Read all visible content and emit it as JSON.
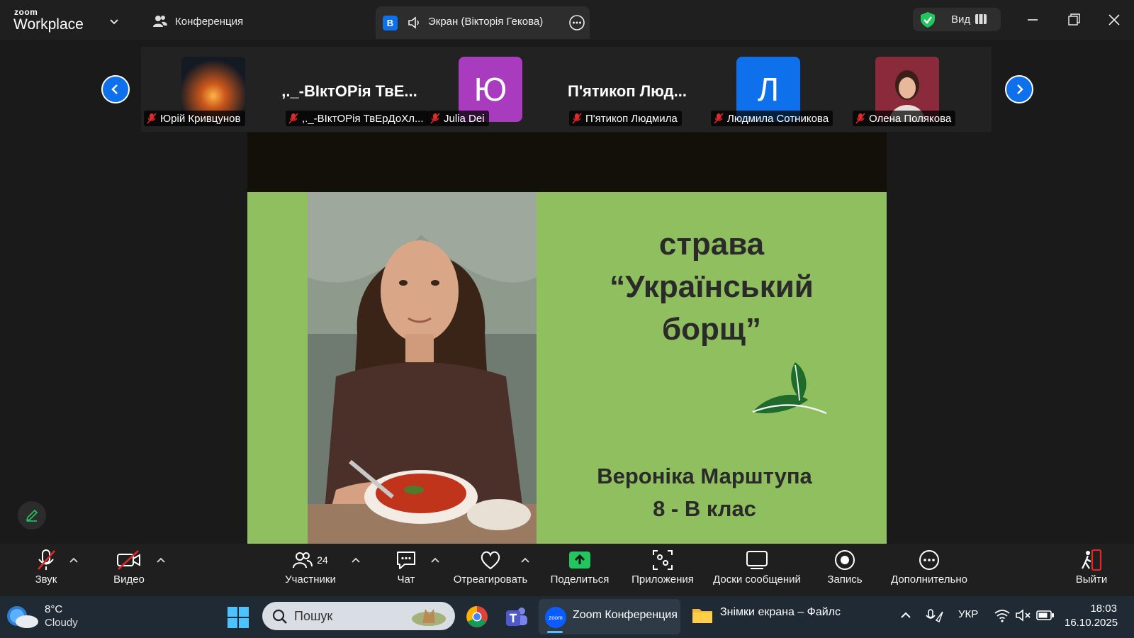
{
  "app": {
    "logo_top": "zoom",
    "logo_bottom": "Workplace"
  },
  "titlebar": {
    "conference_tab": "Конференция",
    "screen_tab_badge": "В",
    "screen_tab_label": "Экран (Вікторія Гекова)",
    "view_label": "Вид"
  },
  "participants": [
    {
      "tile_text": "",
      "name": "Юрій Кривцунов",
      "kind": "photo-fire"
    },
    {
      "tile_text": ",._-ВІктОРія ТвЕ...",
      "name": ",._-ВІктОРія ТвЕрДоХл...",
      "kind": "text"
    },
    {
      "tile_text": "Ю",
      "name": "Julia Dei",
      "kind": "initial",
      "color": "#a93bbf"
    },
    {
      "tile_text": "П'ятикоп Люд...",
      "name": "П'ятикоп Людмила",
      "kind": "text"
    },
    {
      "tile_text": "Л",
      "name": "Людмила Сотникова",
      "kind": "initial",
      "color": "#0e71eb"
    },
    {
      "tile_text": "",
      "name": "Олена Полякова",
      "kind": "photo-woman"
    }
  ],
  "slide": {
    "title_line1": "страва",
    "title_line2": "“Український",
    "title_line3": "борщ”",
    "author_line1": "Вероніка Марштупа",
    "author_line2": "8 - В клас",
    "bg_color": "#8fbf5e"
  },
  "toolbar": {
    "audio": "Звук",
    "video": "Видео",
    "participants": "Участники",
    "participants_count": "24",
    "chat": "Чат",
    "react": "Отреагировать",
    "share": "Поделиться",
    "apps": "Приложения",
    "whiteboards": "Доски сообщений",
    "record": "Запись",
    "more": "Дополнительно",
    "leave": "Выйти"
  },
  "taskbar": {
    "temperature": "8°C",
    "weather": "Cloudy",
    "search_placeholder": "Пошук",
    "zoom_task": "Zoom Конференция",
    "files_task": "Знімки екрана – Файлс",
    "language": "УКР",
    "time": "18:03",
    "date": "16.10.2025"
  },
  "colors": {
    "accent": "#0e71eb",
    "share_green": "#22c55e",
    "leave_red": "#e02828"
  }
}
